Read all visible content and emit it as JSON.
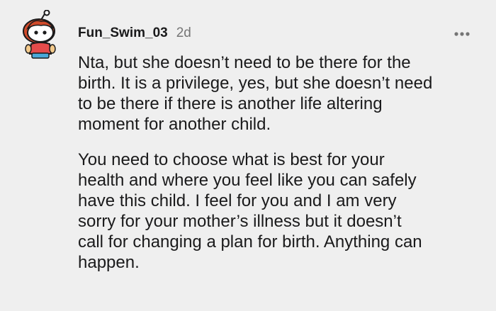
{
  "comment": {
    "author": {
      "username": "Fun_Swim_03",
      "avatar_icon": "snoo-avatar-icon"
    },
    "age": "2d",
    "more_icon": "more-options-icon",
    "paragraphs": [
      "Nta, but she doesn’t need to be there for the\nbirth. It is a privilege, yes, but she doesn’t need\nto be there if there is another life altering\nmoment for another child.",
      "You need to choose what is best for your\nhealth and where you feel like you can safely\nhave this child. I feel for you and I am very\nsorry for your mother’s illness but it doesn’t\ncall for changing a plan for birth. Anything can\nhappen."
    ]
  },
  "colors": {
    "background": "#efefef",
    "text": "#1a1a1b",
    "muted": "#757575",
    "avatar_hair": "#d04a2a",
    "avatar_shirt": "#e54b4b",
    "avatar_pants": "#4aa8d8",
    "avatar_skin": "#f3c98b"
  }
}
